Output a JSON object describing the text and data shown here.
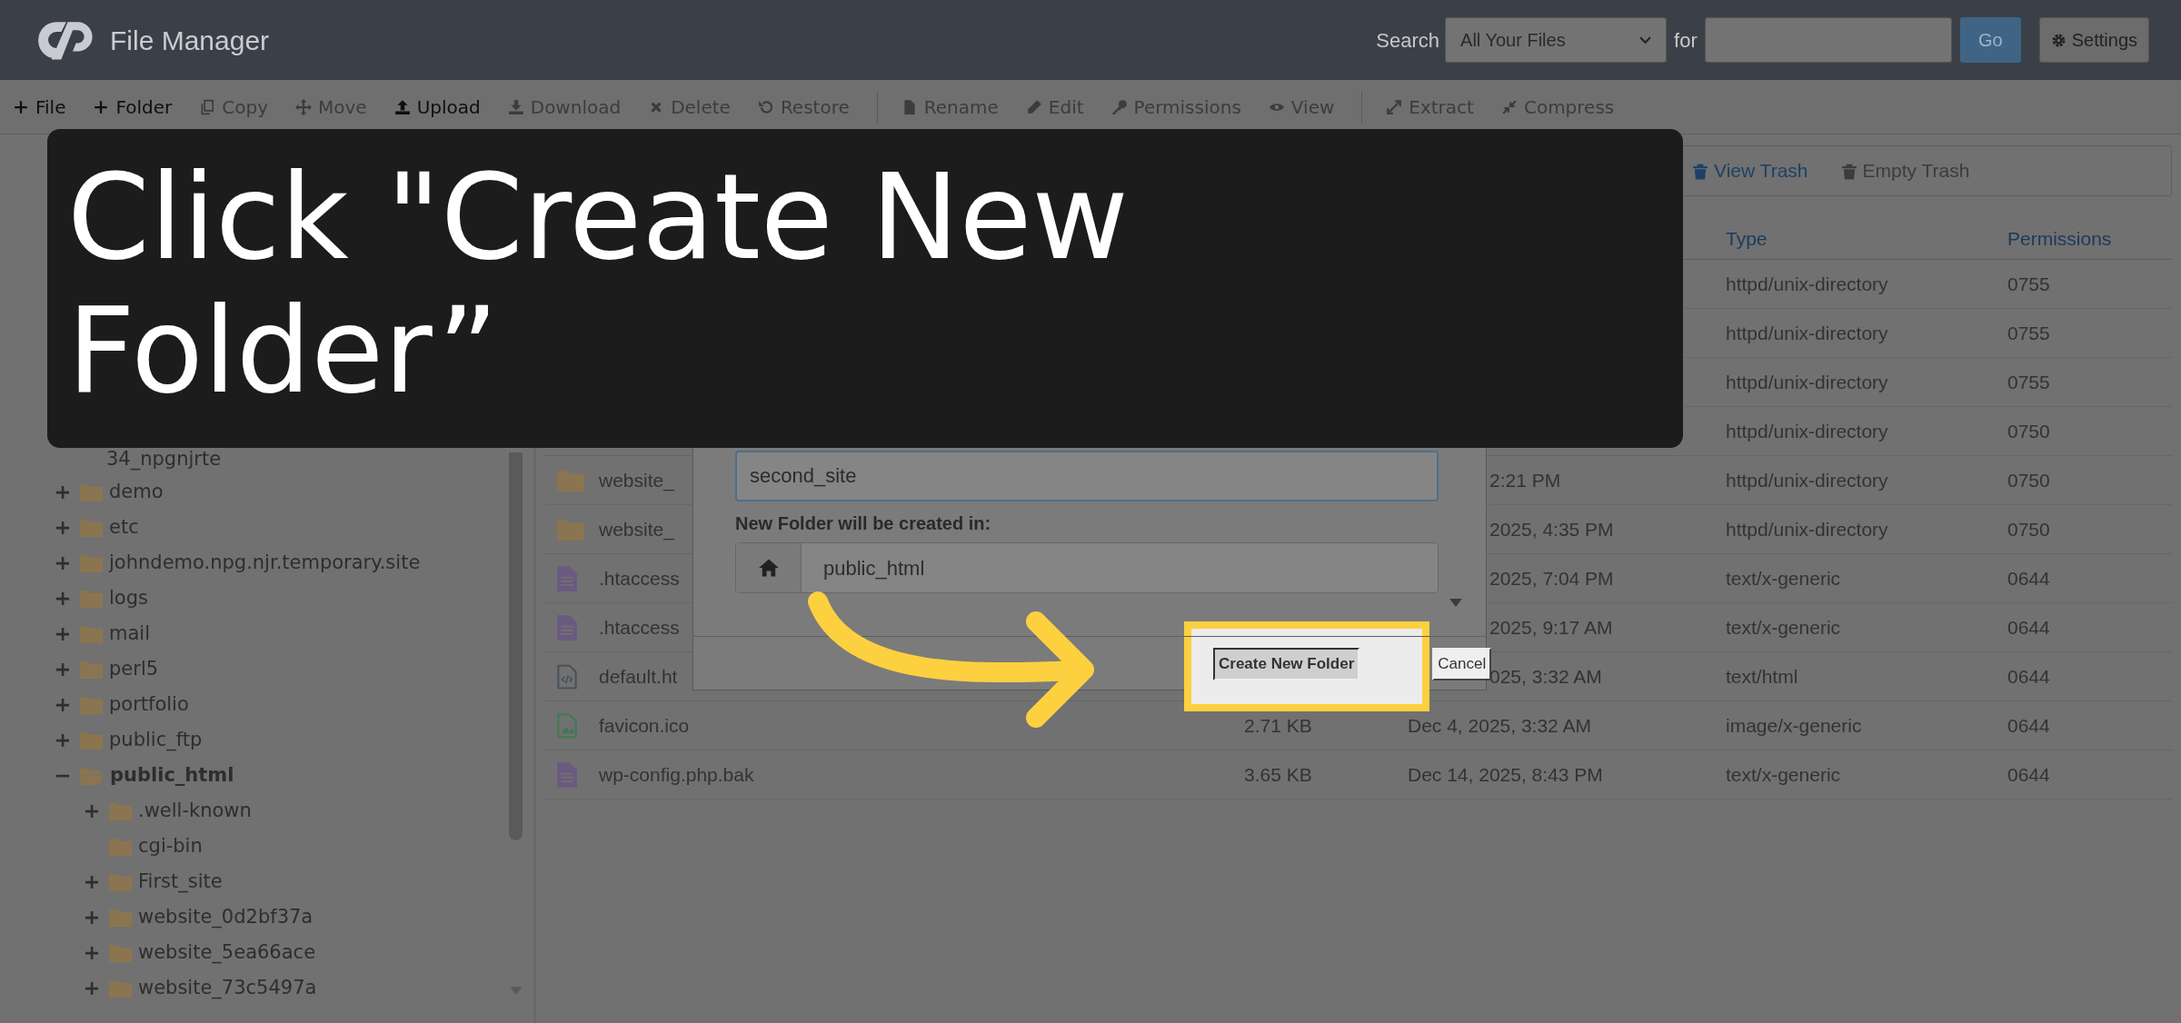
{
  "header": {
    "title": "File Manager",
    "search_label": "Search",
    "search_scope": "All Your Files",
    "for_label": "for",
    "go_button": "Go",
    "settings_button": "Settings"
  },
  "toolbar": [
    [
      {
        "label": "File",
        "disabled": false
      },
      {
        "label": "Folder",
        "disabled": false
      },
      {
        "label": "Copy",
        "disabled": true
      },
      {
        "label": "Move",
        "disabled": true
      },
      {
        "label": "Upload",
        "disabled": false
      },
      {
        "label": "Download",
        "disabled": true
      },
      {
        "label": "Delete",
        "disabled": true
      },
      {
        "label": "Restore",
        "disabled": true
      }
    ],
    [
      {
        "label": "Rename",
        "disabled": true
      },
      {
        "label": "Edit",
        "disabled": true
      },
      {
        "label": "Permissions",
        "disabled": true
      },
      {
        "label": "View",
        "disabled": true
      }
    ],
    [
      {
        "label": "Extract",
        "disabled": true
      },
      {
        "label": "Compress",
        "disabled": true
      }
    ]
  ],
  "tree": [
    {
      "name": "34_npgnjrte",
      "kind": "continuation"
    },
    {
      "name": "demo",
      "kind": "folder",
      "expandable": true,
      "expanded": false
    },
    {
      "name": "etc",
      "kind": "folder",
      "expandable": true,
      "expanded": false
    },
    {
      "name": "johndemo.npg.njr.temporary.site",
      "kind": "folder",
      "expandable": true,
      "expanded": false
    },
    {
      "name": "logs",
      "kind": "folder",
      "expandable": true,
      "expanded": false
    },
    {
      "name": "mail",
      "kind": "folder",
      "expandable": true,
      "expanded": false
    },
    {
      "name": "perl5",
      "kind": "folder",
      "expandable": true,
      "expanded": false
    },
    {
      "name": "portfolio",
      "kind": "folder",
      "expandable": true,
      "expanded": false
    },
    {
      "name": "public_ftp",
      "kind": "folder",
      "expandable": true,
      "expanded": false
    },
    {
      "name": "public_html",
      "kind": "folder",
      "expandable": true,
      "expanded": true,
      "children": [
        {
          "name": ".well-known",
          "kind": "folder",
          "expandable": true,
          "expanded": false
        },
        {
          "name": "cgi-bin",
          "kind": "folder",
          "expandable": false,
          "expanded": false
        },
        {
          "name": "First_site",
          "kind": "folder",
          "expandable": true,
          "expanded": false
        },
        {
          "name": "website_0d2bf37a",
          "kind": "folder",
          "expandable": true,
          "expanded": false
        },
        {
          "name": "website_5ea66ace",
          "kind": "folder",
          "expandable": true,
          "expanded": false
        },
        {
          "name": "website_73c5497a",
          "kind": "folder",
          "expandable": true,
          "expanded": false
        }
      ]
    }
  ],
  "actions": [
    {
      "label": "View Trash",
      "disabled": false
    },
    {
      "label": "Empty Trash",
      "disabled": true
    }
  ],
  "table": {
    "columns": [
      "Type",
      "Permissions"
    ],
    "rows": [
      {
        "type": "httpd/unix-directory",
        "permissions": "0755"
      },
      {
        "type": "httpd/unix-directory",
        "permissions": "0755"
      },
      {
        "type": "httpd/unix-directory",
        "permissions": "0755"
      },
      {
        "type": "httpd/unix-directory",
        "permissions": "0750"
      },
      {
        "kind": "folder",
        "name": "website_",
        "modified_tail": "2:21 PM",
        "type": "httpd/unix-directory",
        "permissions": "0750"
      },
      {
        "kind": "folder",
        "name": "website_",
        "modified_tail": "2025, 4:35 PM",
        "type": "httpd/unix-directory",
        "permissions": "0750"
      },
      {
        "kind": "file",
        "name": ".htaccess",
        "modified_tail": "2025, 7:04 PM",
        "type": "text/x-generic",
        "permissions": "0644"
      },
      {
        "kind": "file",
        "name": ".htaccess",
        "modified_tail": "2025, 9:17 AM",
        "type": "text/x-generic",
        "permissions": "0644"
      },
      {
        "kind": "code",
        "name": "default.ht",
        "modified_tail": "025, 3:32 AM",
        "type": "text/html",
        "permissions": "0644"
      },
      {
        "kind": "image",
        "name": "favicon.ico",
        "size": "2.71 KB",
        "modified": "Dec 4, 2025, 3:32 AM",
        "type": "image/x-generic",
        "permissions": "0644"
      },
      {
        "kind": "file",
        "name": "wp-config.php.bak",
        "size": "3.65 KB",
        "modified": "Dec 14, 2025, 8:43 PM",
        "type": "text/x-generic",
        "permissions": "0644"
      }
    ]
  },
  "dialog": {
    "name_value": "second_site",
    "path_label": "New Folder will be created in:",
    "path_value": "public_html",
    "buttons": [
      {
        "label": "Create New Folder",
        "kind": "primary"
      },
      {
        "label": "Cancel",
        "kind": "secondary"
      }
    ]
  },
  "banner": {
    "text": "Click \"Create New Folder”"
  }
}
